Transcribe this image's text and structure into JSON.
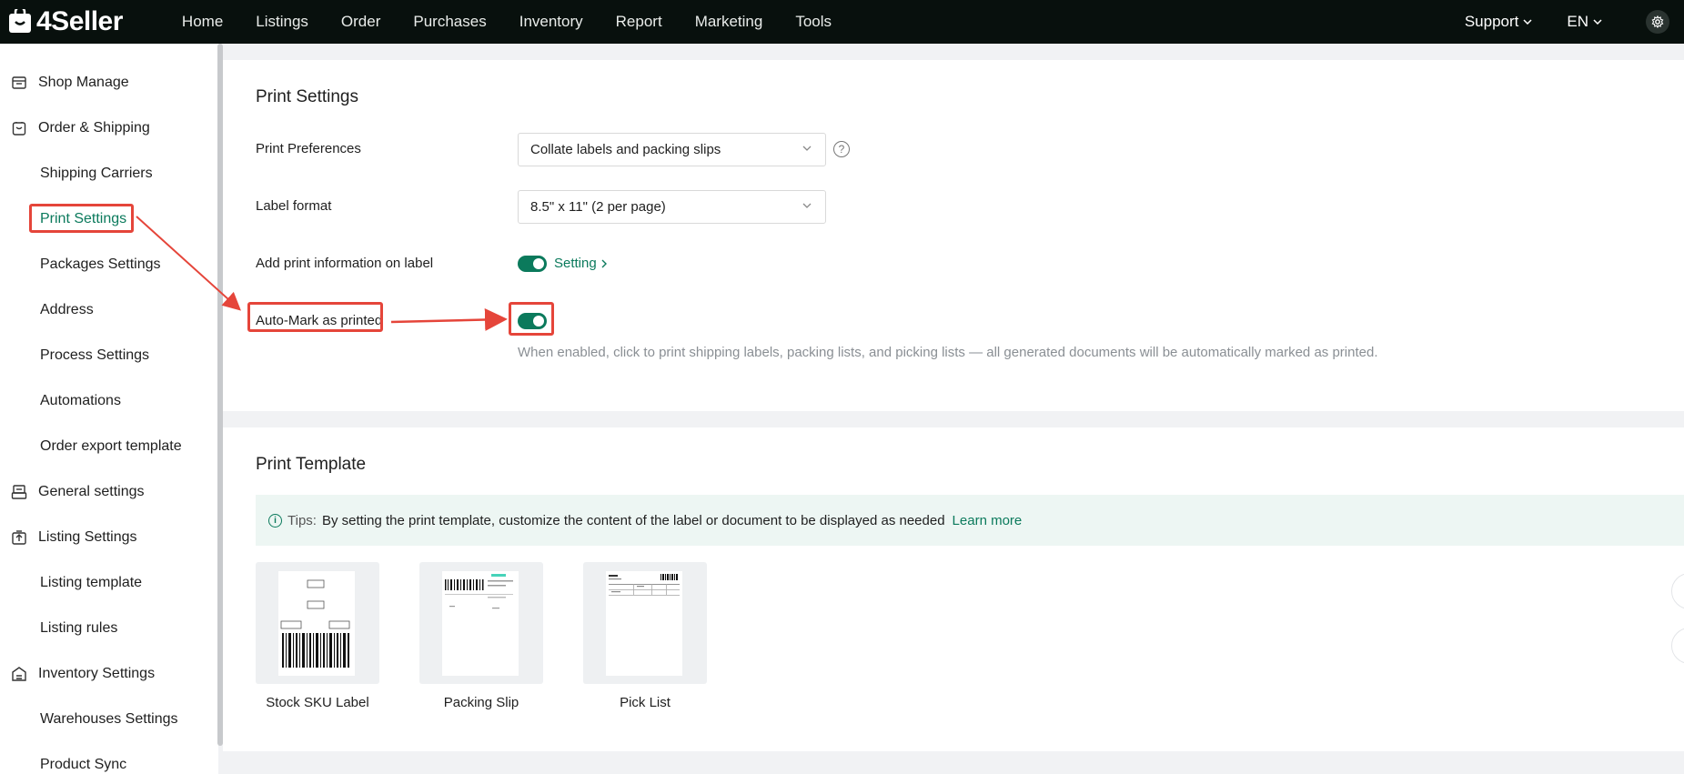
{
  "header": {
    "logo_text": "4Seller",
    "nav": [
      "Home",
      "Listings",
      "Order",
      "Purchases",
      "Inventory",
      "Report",
      "Marketing",
      "Tools"
    ],
    "support_label": "Support",
    "language_label": "EN"
  },
  "sidebar": {
    "items": [
      {
        "label": "Shop Manage",
        "icon": "shop-icon"
      },
      {
        "label": "Order & Shipping",
        "icon": "order-bag-icon"
      },
      {
        "label": "Shipping Carriers"
      },
      {
        "label": "Print Settings"
      },
      {
        "label": "Packages Settings"
      },
      {
        "label": "Address"
      },
      {
        "label": "Process Settings"
      },
      {
        "label": "Automations"
      },
      {
        "label": "Order export template"
      },
      {
        "label": "General settings",
        "icon": "printer-icon"
      },
      {
        "label": "Listing Settings",
        "icon": "upload-icon"
      },
      {
        "label": "Listing template"
      },
      {
        "label": "Listing rules"
      },
      {
        "label": "Inventory Settings",
        "icon": "inventory-icon"
      },
      {
        "label": "Warehouses Settings"
      },
      {
        "label": "Product Sync"
      }
    ],
    "active": "Print Settings"
  },
  "print_settings": {
    "title": "Print Settings",
    "preferences_label": "Print Preferences",
    "preferences_value": "Collate labels and packing slips",
    "label_format_label": "Label format",
    "label_format_value": "8.5\" x 11\" (2 per page)",
    "add_info_label": "Add print information on label",
    "add_info_enabled": true,
    "setting_link": "Setting",
    "auto_mark_label": "Auto-Mark as printed",
    "auto_mark_enabled": true,
    "auto_mark_desc": "When enabled, click to print shipping labels, packing lists, and picking lists — all generated documents will be automatically marked as printed."
  },
  "print_template": {
    "title": "Print Template",
    "tips_label": "Tips:",
    "tips_text": "By setting the print template, customize the content of the label or document to be displayed as needed",
    "learn_more": "Learn more",
    "templates": [
      "Stock SKU Label",
      "Packing Slip",
      "Pick List"
    ]
  },
  "colors": {
    "accent": "#0b7a5c",
    "annotation": "#e5453a",
    "topbar": "#08100d"
  }
}
